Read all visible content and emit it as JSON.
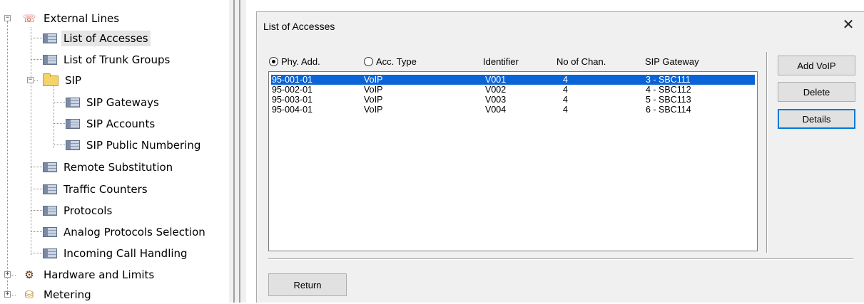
{
  "tree": {
    "external_lines": "External Lines",
    "list_of_accesses": "List of Accesses",
    "list_of_trunk_groups": "List of Trunk Groups",
    "sip": "SIP",
    "sip_gateways": "SIP Gateways",
    "sip_accounts": "SIP Accounts",
    "sip_public_numbering": "SIP Public Numbering",
    "remote_substitution": "Remote Substitution",
    "traffic_counters": "Traffic Counters",
    "protocols": "Protocols",
    "analog_protocols_selection": "Analog Protocols Selection",
    "incoming_call_handling": "Incoming Call Handling",
    "hardware_and_limits": "Hardware and Limits",
    "metering": "Metering",
    "expand_symbol": "+",
    "collapse_symbol": "−"
  },
  "dialog": {
    "title": "List of Accesses",
    "close_glyph": "✕",
    "columns": {
      "phy_add": "Phy. Add.",
      "acc_type": "Acc. Type",
      "identifier": "Identifier",
      "no_of_chan": "No of Chan.",
      "sip_gateway": "SIP Gateway"
    },
    "sort_selected": "phy_add",
    "rows": [
      {
        "phy_add": "95-001-01",
        "acc_type": "VoIP",
        "identifier": "V001",
        "no_of_chan": "4",
        "sip_gateway": "3 - SBC111",
        "selected": true
      },
      {
        "phy_add": "95-002-01",
        "acc_type": "VoIP",
        "identifier": "V002",
        "no_of_chan": "4",
        "sip_gateway": "4 - SBC112",
        "selected": false
      },
      {
        "phy_add": "95-003-01",
        "acc_type": "VoIP",
        "identifier": "V003",
        "no_of_chan": "4",
        "sip_gateway": "5 - SBC113",
        "selected": false
      },
      {
        "phy_add": "95-004-01",
        "acc_type": "VoIP",
        "identifier": "V004",
        "no_of_chan": "4",
        "sip_gateway": "6 - SBC114",
        "selected": false
      }
    ],
    "buttons": {
      "add_voip": "Add VoIP",
      "delete": "Delete",
      "details": "Details",
      "return": "Return"
    }
  },
  "colors": {
    "selection": "#0a64d7",
    "tree_selection": "#e5e5e5",
    "dialog_bg": "#f0f0f0"
  }
}
